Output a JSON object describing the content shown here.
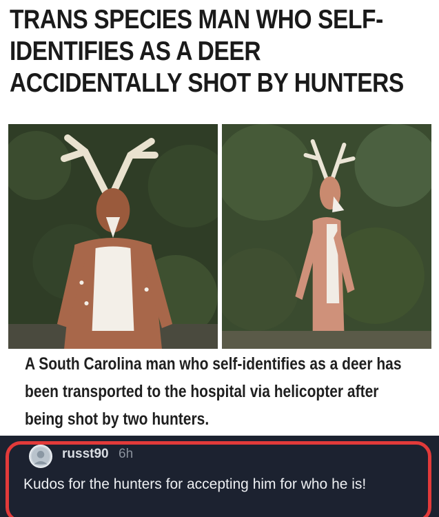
{
  "article": {
    "headline": "TRANS SPECIES MAN WHO SELF-IDENTIFIES AS A DEER ACCIDENTALLY SHOT BY HUNTERS",
    "caption": "A South Carolina man who self-identifies as a deer has been transported to the hospital via helicopter after being shot by two hunters."
  },
  "comment": {
    "username": "russt90",
    "timestamp": "6h",
    "text": "Kudos for the hunters for accepting him for who he is!",
    "highlight_color": "#e23a3a"
  },
  "photos": [
    {
      "name": "deer-costume-front-photo"
    },
    {
      "name": "deer-costume-side-photo"
    }
  ]
}
